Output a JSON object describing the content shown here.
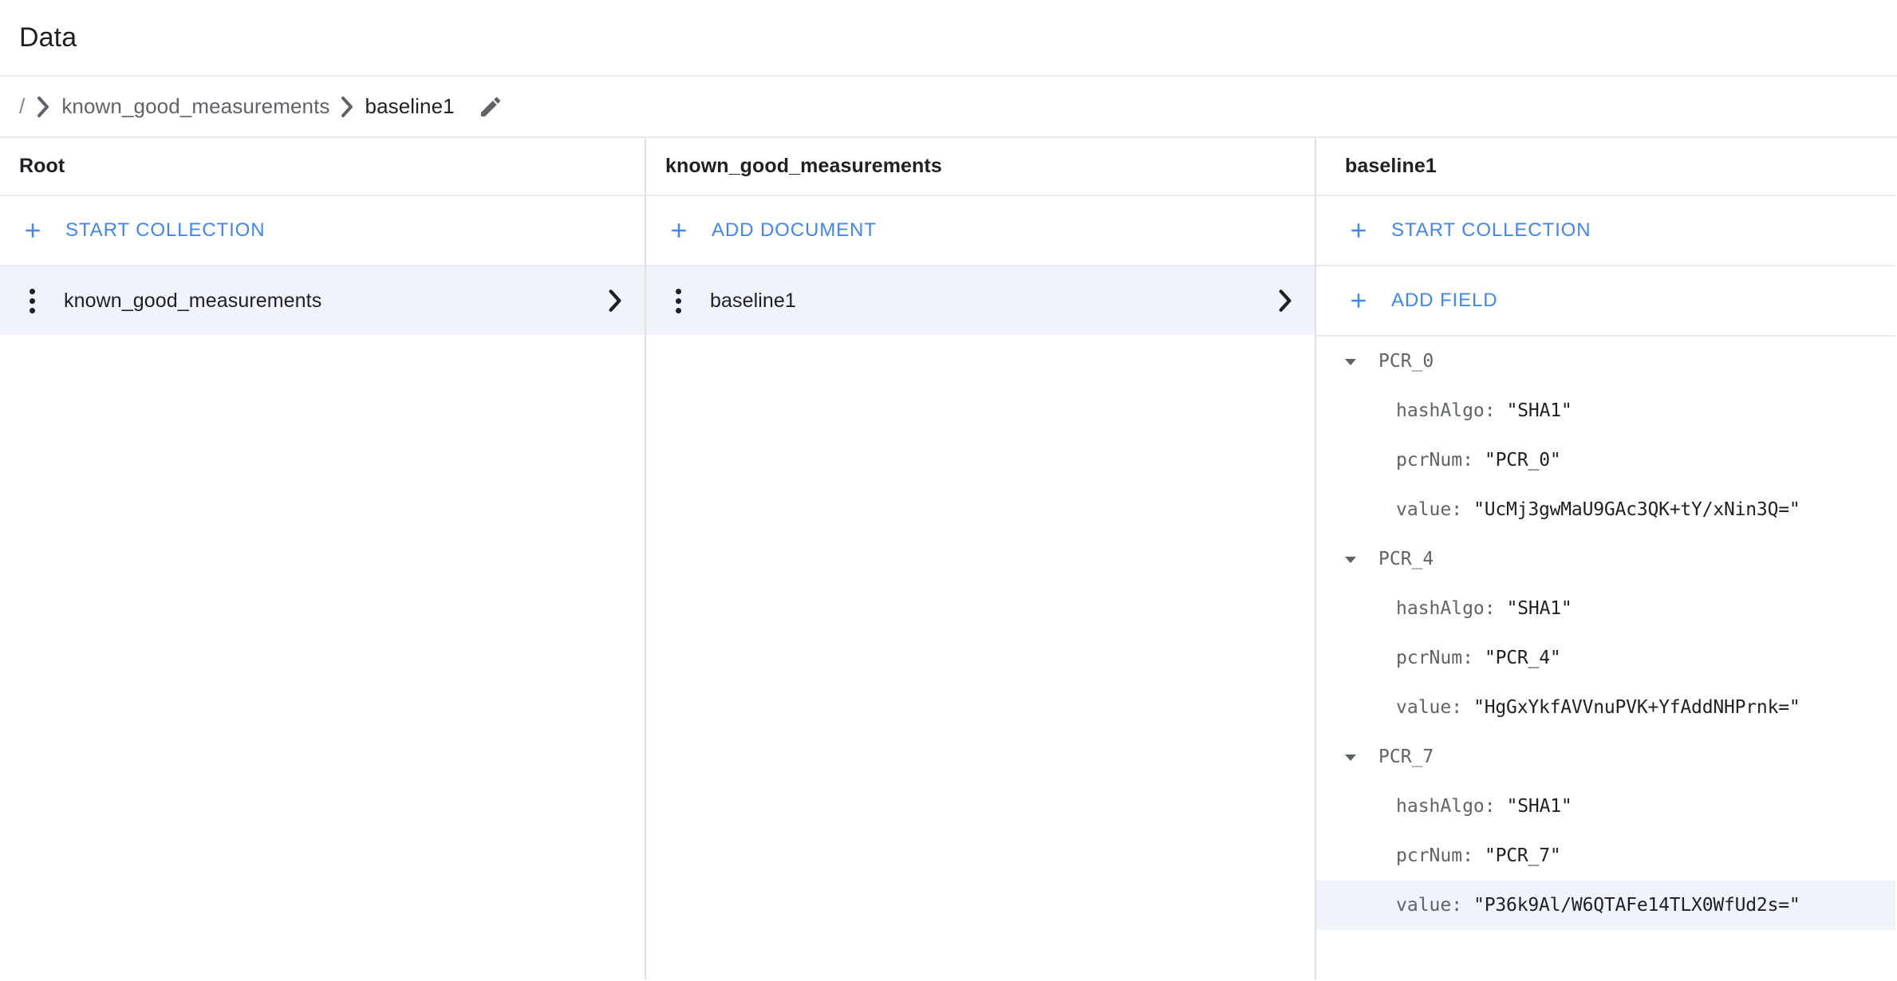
{
  "header": {
    "title": "Data"
  },
  "breadcrumb": {
    "root": "/",
    "separator_icon": "chevron-right-icon",
    "items": [
      {
        "label": "known_good_measurements",
        "active": false
      },
      {
        "label": "baseline1",
        "active": true
      }
    ],
    "edit_icon": "pencil-icon"
  },
  "panels": {
    "root_panel": {
      "header": "Root",
      "action": {
        "label": "START COLLECTION",
        "icon": "plus-icon"
      },
      "rows": [
        {
          "label": "known_good_measurements",
          "selected": true,
          "menu_icon": "more-vert-icon",
          "chevron_icon": "chevron-right-icon"
        }
      ]
    },
    "collection_panel": {
      "header": "known_good_measurements",
      "action": {
        "label": "ADD DOCUMENT",
        "icon": "plus-icon"
      },
      "rows": [
        {
          "label": "baseline1",
          "selected": true,
          "menu_icon": "more-vert-icon",
          "chevron_icon": "chevron-right-icon"
        }
      ]
    },
    "document_panel": {
      "header": "baseline1",
      "actions": [
        {
          "label": "START COLLECTION",
          "icon": "plus-icon"
        },
        {
          "label": "ADD FIELD",
          "icon": "plus-icon"
        }
      ],
      "field_groups": [
        {
          "name": "PCR_0",
          "expanded": true,
          "caret_icon": "caret-down-icon",
          "fields": [
            {
              "key": "hashAlgo",
              "value": "\"SHA1\"",
              "highlighted": false
            },
            {
              "key": "pcrNum",
              "value": "\"PCR_0\"",
              "highlighted": false
            },
            {
              "key": "value",
              "value": "\"UcMj3gwMaU9GAc3QK+tY/xNin3Q=\"",
              "highlighted": false
            }
          ]
        },
        {
          "name": "PCR_4",
          "expanded": true,
          "caret_icon": "caret-down-icon",
          "fields": [
            {
              "key": "hashAlgo",
              "value": "\"SHA1\"",
              "highlighted": false
            },
            {
              "key": "pcrNum",
              "value": "\"PCR_4\"",
              "highlighted": false
            },
            {
              "key": "value",
              "value": "\"HgGxYkfAVVnuPVK+YfAddNHPrnk=\"",
              "highlighted": false
            }
          ]
        },
        {
          "name": "PCR_7",
          "expanded": true,
          "caret_icon": "caret-down-icon",
          "fields": [
            {
              "key": "hashAlgo",
              "value": "\"SHA1\"",
              "highlighted": false
            },
            {
              "key": "pcrNum",
              "value": "\"PCR_7\"",
              "highlighted": false
            },
            {
              "key": "value",
              "value": "\"P36k9Al/W6QTAFe14TLX0WfUd2s=\"",
              "highlighted": true
            }
          ]
        }
      ]
    }
  },
  "colors": {
    "accent_blue": "#4285f4",
    "selected_row": "#f1f3fb",
    "text_primary": "#202124",
    "text_secondary": "#5f6368",
    "divider": "#e8eaed"
  }
}
